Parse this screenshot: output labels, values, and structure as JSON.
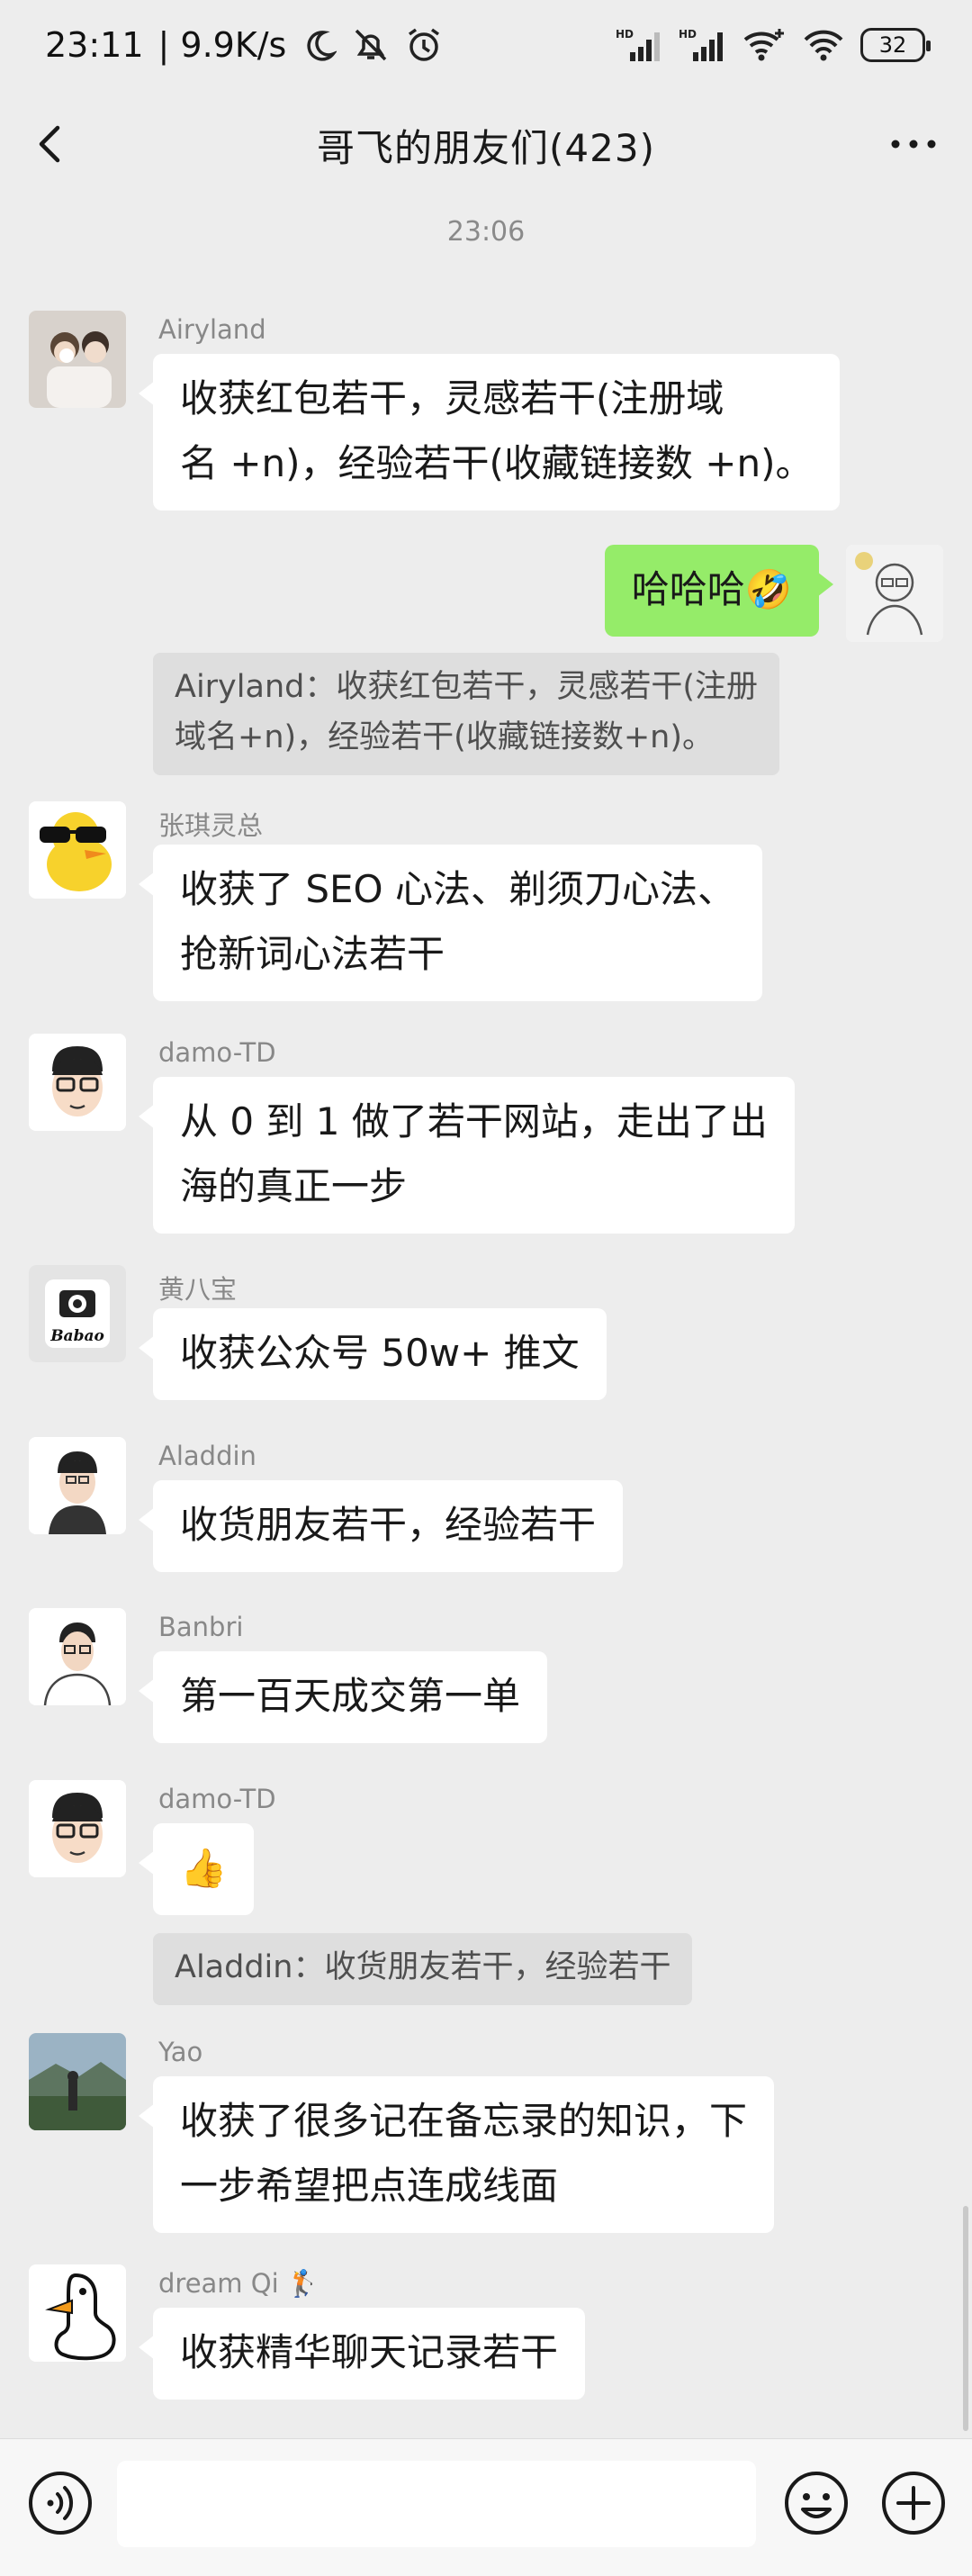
{
  "status_bar": {
    "time": "23:11",
    "net_speed": "| 9.9K/s",
    "battery": "32"
  },
  "nav": {
    "title": "哥飞的朋友们(423)"
  },
  "time_separator": "23:06",
  "messages": [
    {
      "sender": "Airyland",
      "text": "收获红包若干，灵感若干(注册域\n名 +n)，经验若干(收藏链接数 +n)。"
    },
    {
      "text": "哈哈哈🤣"
    },
    {
      "quote": "Airyland：收获红包若干，灵感若干(注册\n域名+n)，经验若干(收藏链接数+n)。"
    },
    {
      "sender": "张琪灵总",
      "text": "收获了 SEO 心法、剃须刀心法、\n抢新词心法若干"
    },
    {
      "sender": "damo-TD",
      "text": "从 0 到 1 做了若干网站，走出了出\n海的真正一步"
    },
    {
      "sender": "黄八宝",
      "text": "收获公众号 50w+ 推文",
      "avatar_text": "Babao"
    },
    {
      "sender": "Aladdin",
      "text": "收货朋友若干，经验若干"
    },
    {
      "sender": "Banbri",
      "text": "第一百天成交第一单"
    },
    {
      "sender": "damo-TD",
      "text": "👍"
    },
    {
      "quote": "Aladdin：收货朋友若干，经验若干"
    },
    {
      "sender": "Yao",
      "text": "收获了很多记在备忘录的知识，下\n一步希望把点连成线面"
    },
    {
      "sender": "dream Qi 🏌",
      "text": "收获精华聊天记录若干"
    }
  ],
  "input": {
    "placeholder": ""
  },
  "icons": {
    "back": "back-arrow-icon",
    "more": "more-dots-icon",
    "voice": "voice-icon",
    "emoji": "emoji-icon",
    "plus": "plus-icon"
  },
  "colors": {
    "background": "#ededed",
    "bubble_self": "#95ec69",
    "bubble_other": "#ffffff",
    "quote_bg": "#dedede"
  }
}
